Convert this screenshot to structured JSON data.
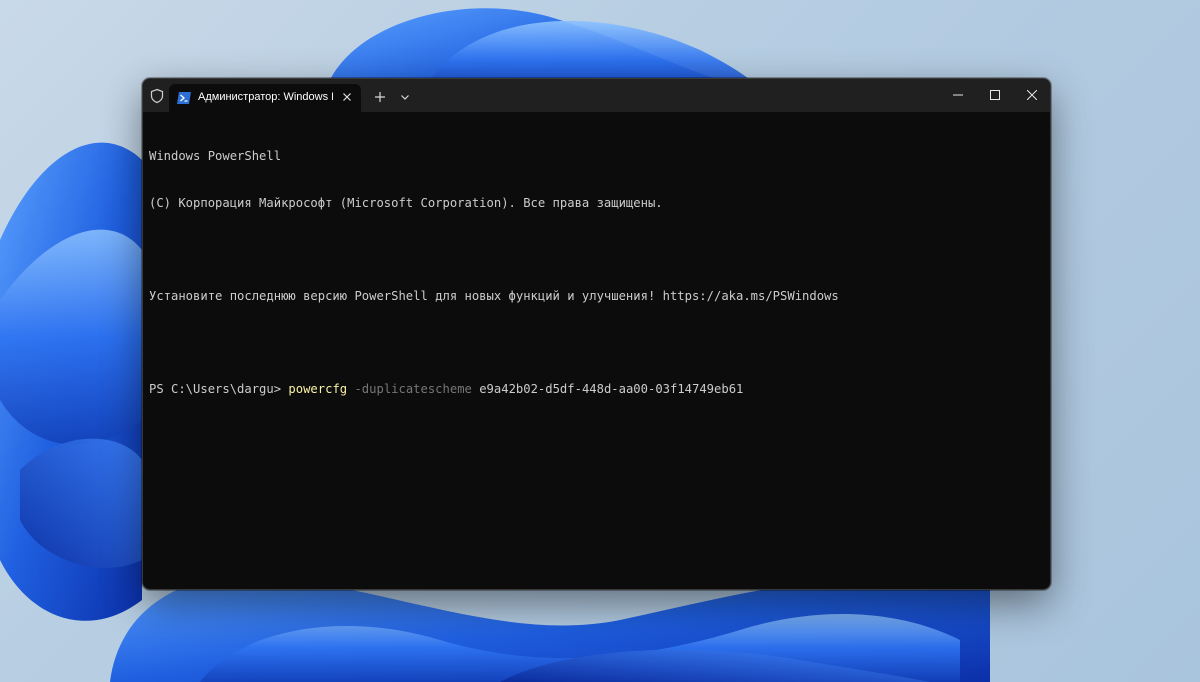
{
  "window": {
    "tab_title": "Администратор: Windows PowerShell",
    "new_tab_icon": "plus-icon",
    "dropdown_icon": "chevron-down-icon",
    "admin_icon": "shield-icon",
    "tab_icon": "powershell-icon"
  },
  "console": {
    "line1": "Windows PowerShell",
    "line2": "(C) Корпорация Майкрософт (Microsoft Corporation). Все права защищены.",
    "line3": "Установите последнюю версию PowerShell для новых функций и улучшения! https://aka.ms/PSWindows",
    "prompt": "PS C:\\Users\\dargu> ",
    "command": "powercfg",
    "parameter": "-duplicatescheme",
    "argument": "e9a42b02-d5df-448d-aa00-03f14749eb61"
  },
  "colors": {
    "console_background": "#0c0c0c",
    "title_bar": "#202020",
    "command_color": "#f9f1a5",
    "parameter_color": "#767676",
    "text_color": "#cccccc",
    "wallpaper_accent": "#1f5fe0"
  }
}
